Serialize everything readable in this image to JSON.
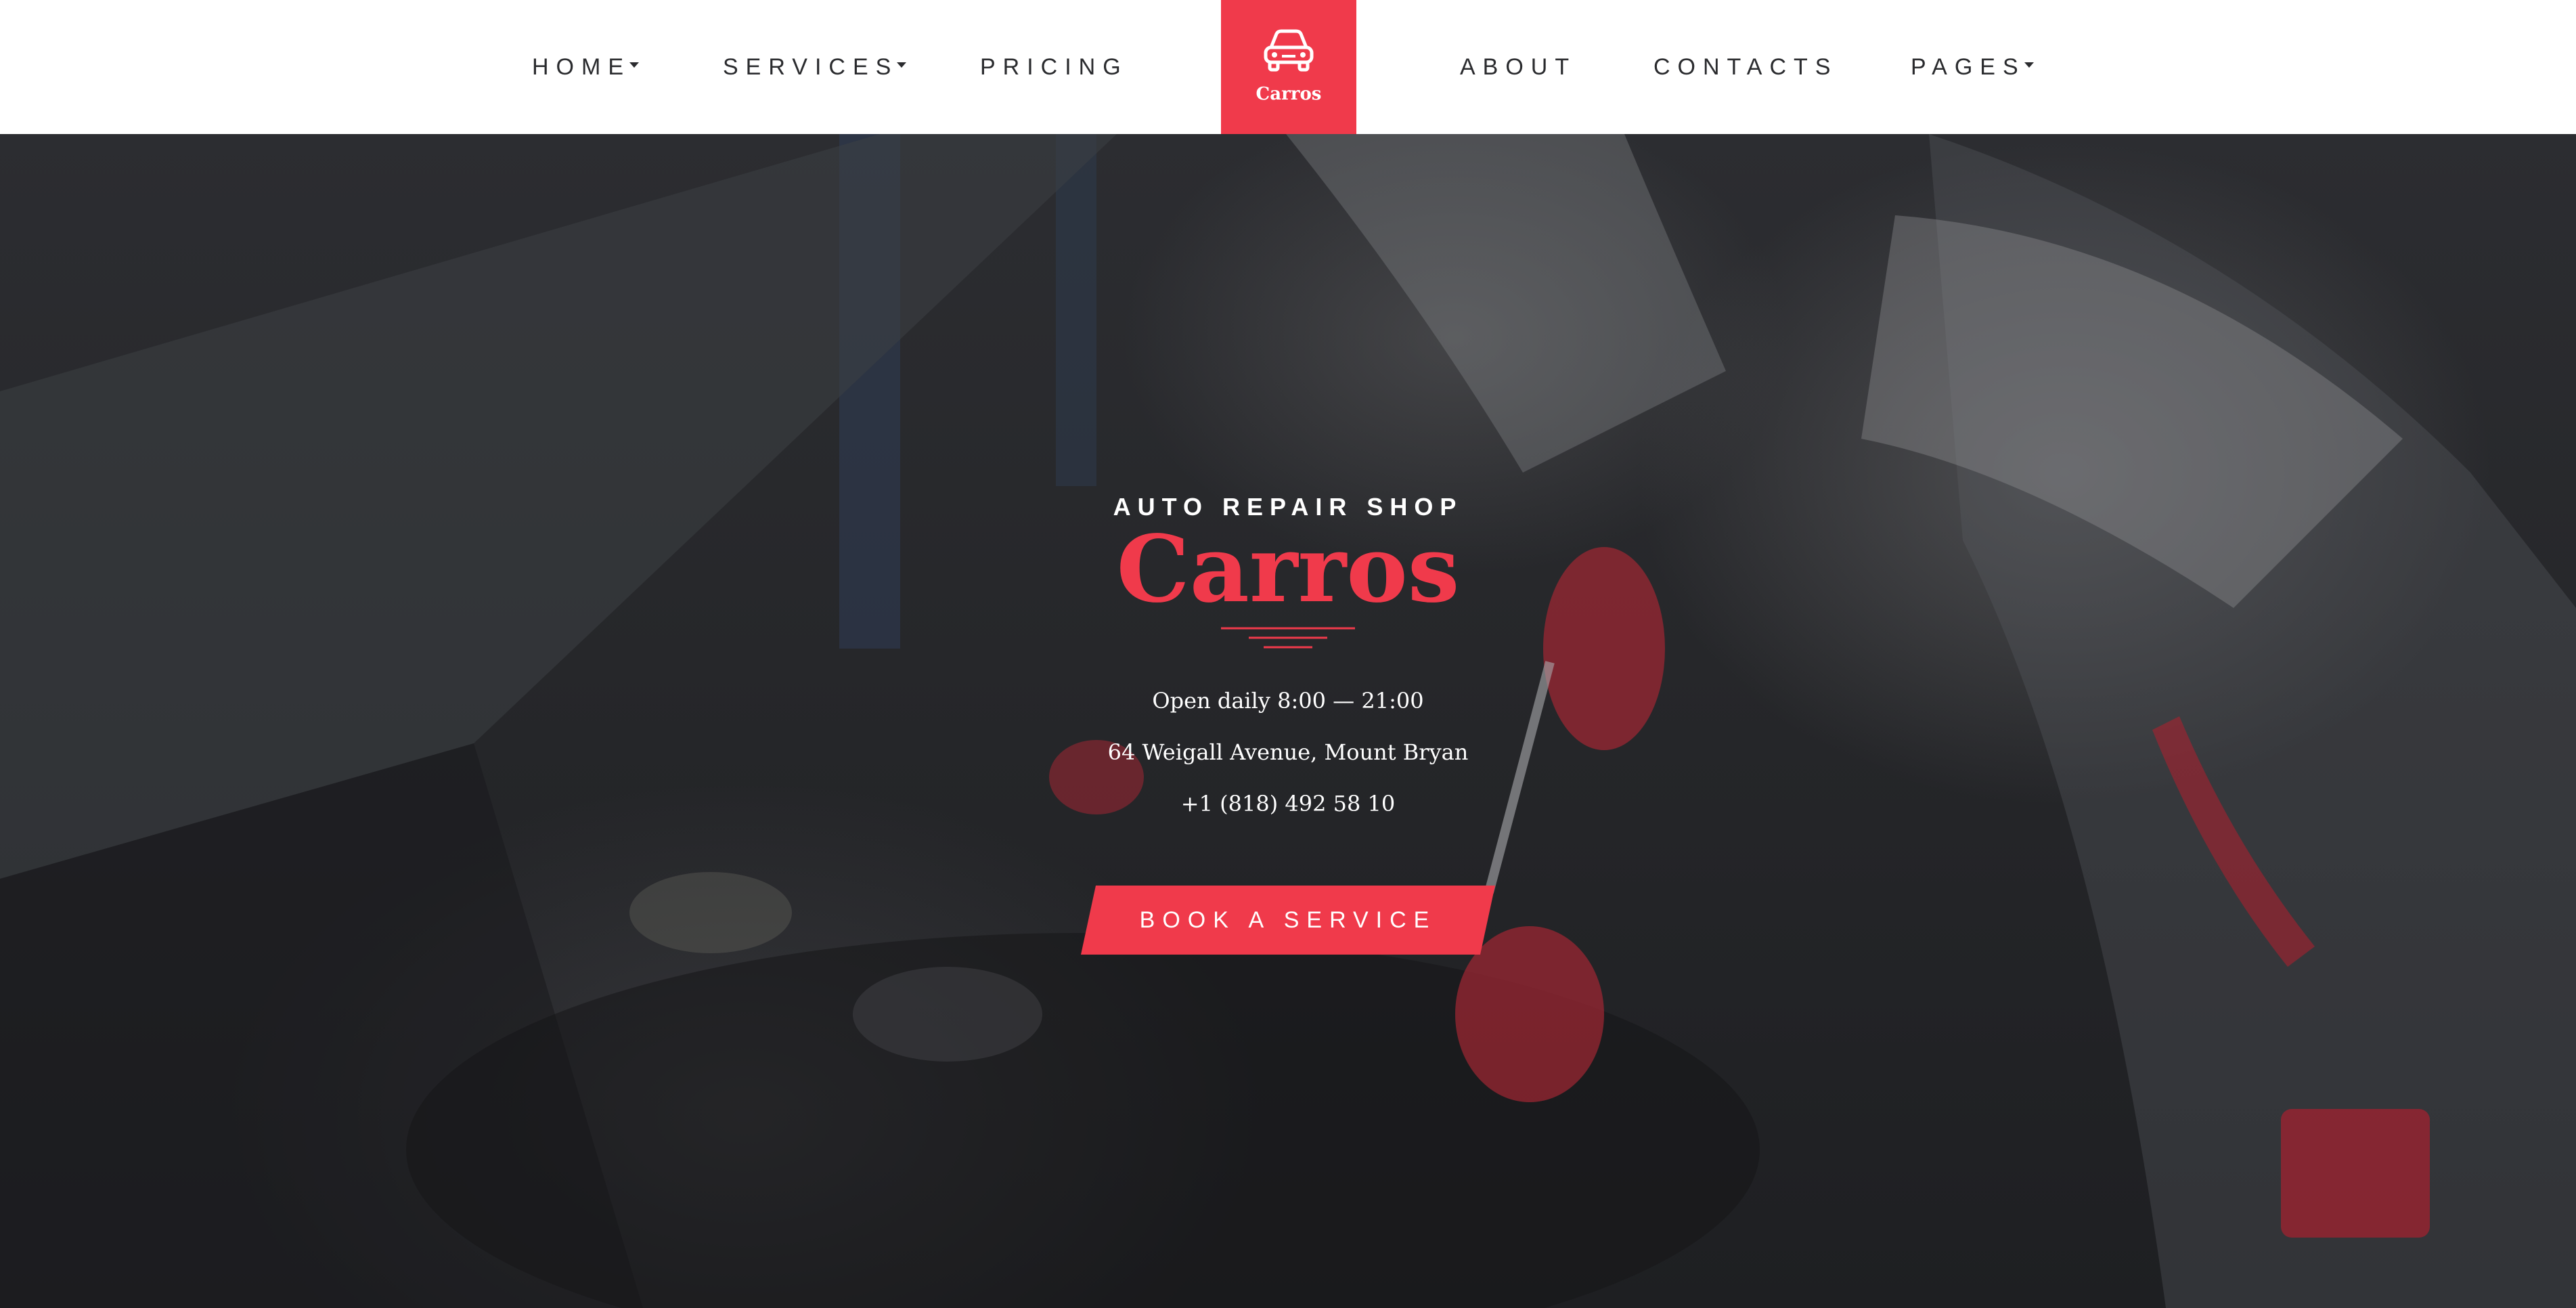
{
  "nav": {
    "home": "HOME",
    "services": "SERVICES",
    "pricing": "PRICING",
    "about": "ABOUT",
    "contacts": "CONTACTS",
    "pages": "PAGES"
  },
  "logo": {
    "icon": "car-icon",
    "text": "Carros"
  },
  "hero": {
    "subtitle": "AUTO REPAIR SHOP",
    "title": "Carros",
    "hours": "Open daily 8:00 — 21:00",
    "address": "64 Weigall Avenue, Mount Bryan",
    "phone": "+1 (818) 492 58 10",
    "cta": "BOOK A SERVICE"
  },
  "colors": {
    "accent": "#f03a4b",
    "header_bg": "#ffffff",
    "nav_text": "#2a2b2e",
    "hero_text": "#ffffff"
  }
}
